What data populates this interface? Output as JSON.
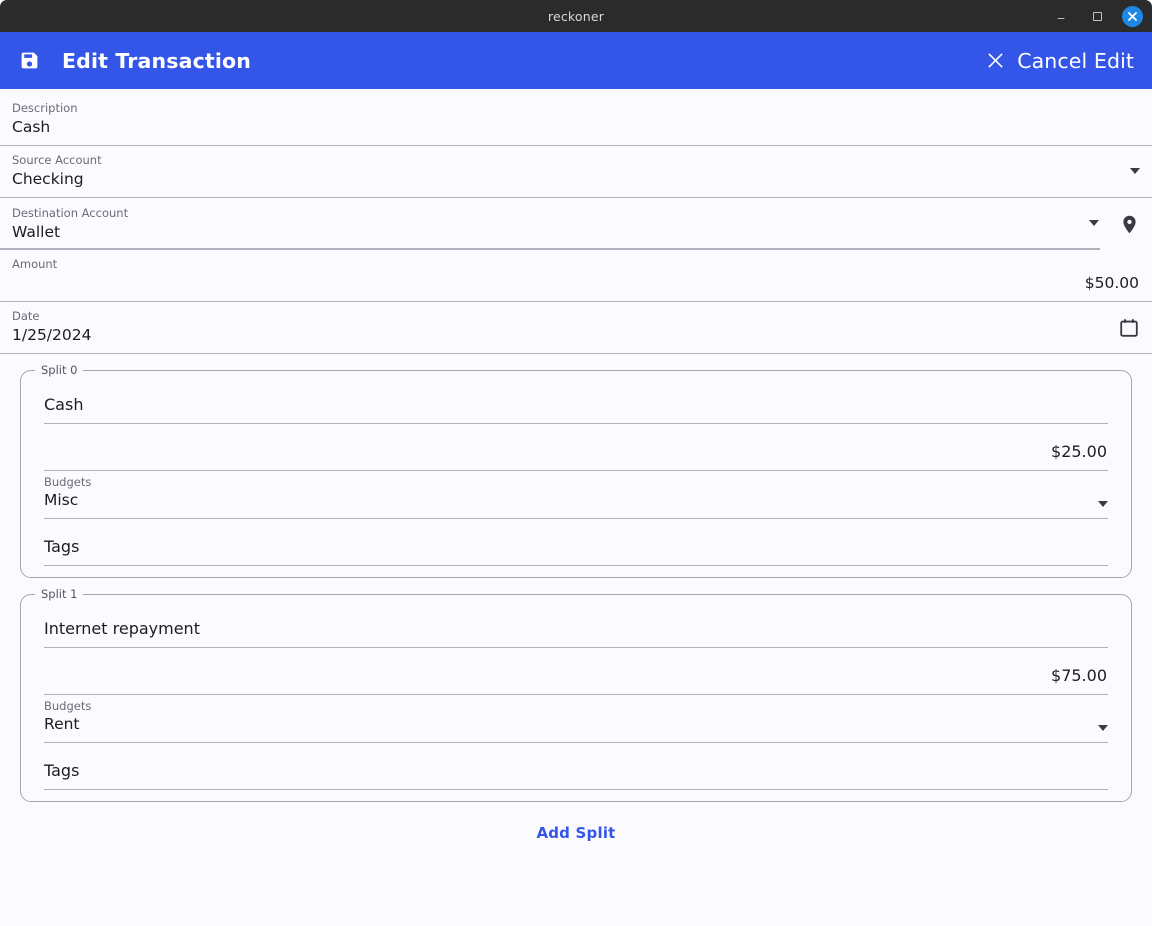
{
  "window": {
    "title": "reckoner",
    "controls": {
      "minimize": "minimize-button",
      "maximize": "maximize-button",
      "close": "close-button"
    }
  },
  "appbar": {
    "save_icon": "save-icon",
    "title": "Edit Transaction",
    "cancel_icon": "close-icon",
    "cancel_label": "Cancel Edit",
    "background_color": "#3355e8",
    "text_color": "#ffffff"
  },
  "form": {
    "description": {
      "label": "Description",
      "value": "Cash"
    },
    "source_account": {
      "label": "Source Account",
      "value": "Checking",
      "dropdown_icon": "chevron-down-icon"
    },
    "destination_account": {
      "label": "Destination Account",
      "value": "Wallet",
      "dropdown_icon": "chevron-down-icon",
      "location_icon": "location-pin-icon"
    },
    "amount": {
      "label": "Amount",
      "value": "$50.00"
    },
    "date": {
      "label": "Date",
      "value": "1/25/2024",
      "calendar_icon": "calendar-icon"
    }
  },
  "splits": [
    {
      "legend": "Split 0",
      "description": "Cash",
      "amount": "$25.00",
      "budgets_label": "Budgets",
      "budgets_value": "Misc",
      "budgets_dropdown_icon": "chevron-down-icon",
      "tags": "Tags"
    },
    {
      "legend": "Split 1",
      "description": "Internet repayment",
      "amount": "$75.00",
      "budgets_label": "Budgets",
      "budgets_value": "Rent",
      "budgets_dropdown_icon": "chevron-down-icon",
      "tags": "Tags"
    }
  ],
  "actions": {
    "add_split_label": "Add Split",
    "add_split_color": "#3355e8"
  },
  "colors": {
    "page_background": "#fbfaff",
    "titlebar_background": "#2b2b2b",
    "divider": "#b3b0bd",
    "label_text": "#6d6a77",
    "value_text": "#1d1c21",
    "close_button": "#1e88e5"
  }
}
